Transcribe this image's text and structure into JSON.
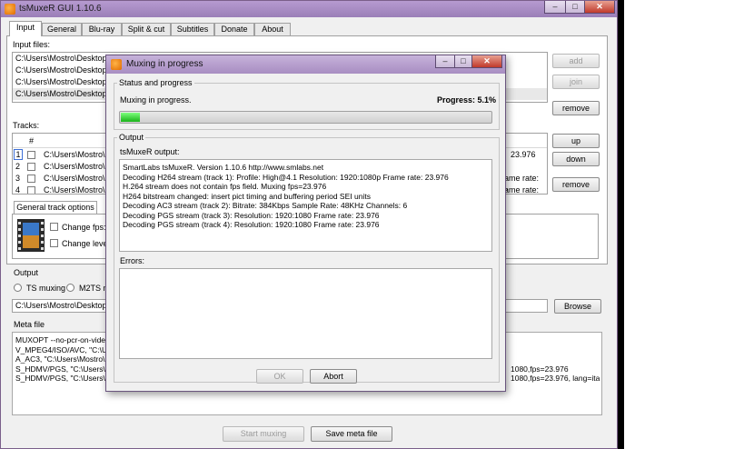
{
  "main_window": {
    "title": "tsMuxeR GUI 1.10.6",
    "caption_buttons": {
      "minimize": "–",
      "maximize": "□",
      "close": "✕"
    },
    "tabs": [
      {
        "label": "Input"
      },
      {
        "label": "General"
      },
      {
        "label": "Blu-ray"
      },
      {
        "label": "Split & cut"
      },
      {
        "label": "Subtitles"
      },
      {
        "label": "Donate"
      },
      {
        "label": "About"
      }
    ],
    "input_files_label": "Input files:",
    "input_files": [
      "C:\\Users\\Mostro\\Desktop\\",
      "C:\\Users\\Mostro\\Desktop\\",
      "C:\\Users\\Mostro\\Desktop\\",
      "C:\\Users\\Mostro\\Desktop\\"
    ],
    "file_buttons": {
      "add": "add",
      "join": "join",
      "remove": "remove"
    },
    "tracks_label": "Tracks:",
    "tracks_header": "#",
    "tracks": [
      {
        "num": "1",
        "path": "C:\\Users\\Mostro\\D",
        "right": "23.976"
      },
      {
        "num": "2",
        "path": "C:\\Users\\Mostro\\D",
        "right": ""
      },
      {
        "num": "3",
        "path": "C:\\Users\\Mostro\\D",
        "right": "rame rate: ..."
      },
      {
        "num": "4",
        "path": "C:\\Users\\Mostro\\D",
        "right": "rame rate: ..."
      }
    ],
    "track_buttons": {
      "up": "up",
      "down": "down",
      "remove": "remove"
    },
    "general_track_options": "General track options",
    "change_fps": "Change fps:",
    "change_level": "Change level:",
    "output_label": "Output",
    "ts_muxing": "TS muxing",
    "m2ts_muxing": "M2TS mu",
    "output_path": "C:\\Users\\Mostro\\Desktop\\Ava",
    "browse": "Browse",
    "meta_file_label": "Meta file",
    "meta_lines": [
      {
        "left": "MUXOPT --no-pcr-on-video-p",
        "right": ""
      },
      {
        "left": "V_MPEG4/ISO/AVC, \"C:\\Users",
        "right": ""
      },
      {
        "left": "A_AC3, \"C:\\Users\\Mostro\\De",
        "right": ""
      },
      {
        "left": "S_HDMV/PGS, \"C:\\Users\\Mos",
        "right": "1080,fps=23.976"
      },
      {
        "left": "S_HDMV/PGS, \"C:\\Users\\Mos",
        "right": "1080,fps=23.976, lang=ita"
      }
    ],
    "start_muxing": "Start muxing",
    "save_meta_file": "Save meta file"
  },
  "dialog": {
    "title": "Muxing in progress",
    "status_group": "Status and progress",
    "status_text": "Muxing in progress.",
    "progress_label": "Progress: 5.1%",
    "progress_fraction": 0.051,
    "output_group": "Output",
    "tsmuxer_output_label": "tsMuxeR output:",
    "output_lines": [
      "SmartLabs tsMuxeR.  Version 1.10.6  http://www.smlabs.net",
      "Decoding H264 stream (track 1): Profile: High@4.1  Resolution: 1920:1080p  Frame rate: 23.976",
      "H.264 stream does not contain fps field. Muxing fps=23.976",
      "H264 bitstream changed: insert pict timing and buffering period SEI units",
      "Decoding AC3 stream (track 2): Bitrate: 384Kbps Sample Rate: 48KHz Channels: 6",
      "Decoding PGS stream (track 3):  Resolution: 1920:1080  Frame rate: 23.976",
      "Decoding PGS stream (track 4):  Resolution: 1920:1080  Frame rate: 23.976"
    ],
    "errors_label": "Errors:",
    "ok": "OK",
    "abort": "Abort"
  }
}
